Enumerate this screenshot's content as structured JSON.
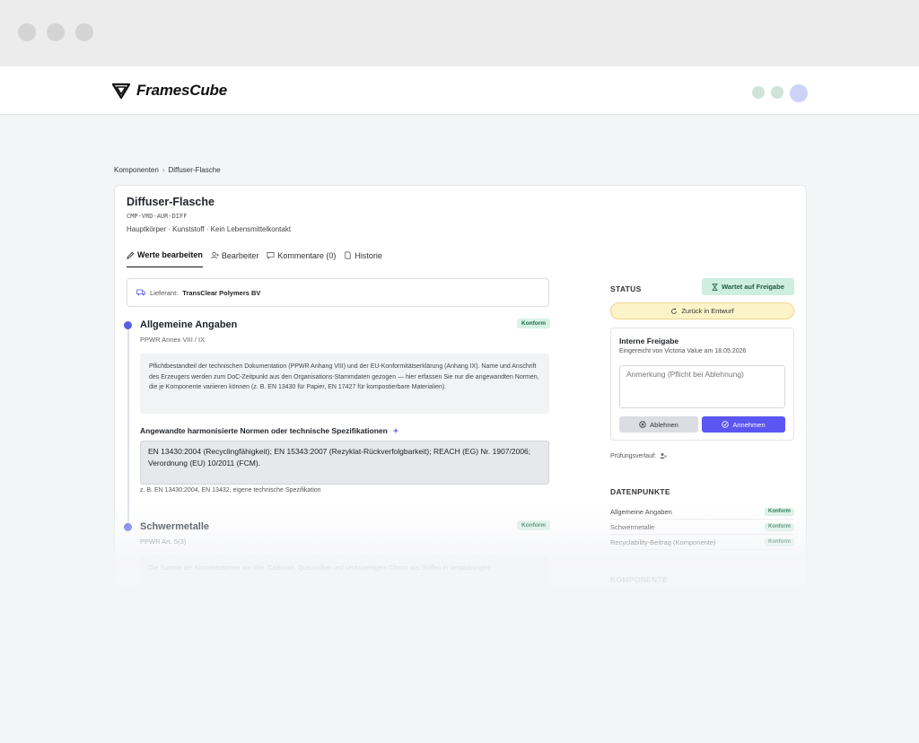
{
  "app": {
    "logo_text": "FramesCube"
  },
  "breadcrumb": {
    "parent": "Komponenten",
    "separator": "›",
    "current": "Diffuser-Flasche"
  },
  "component": {
    "title": "Diffuser-Flasche",
    "code": "CMP-VRD-AUR-DIFF",
    "meta": "Hauptkörper · Kunststoff · Kein Lebensmittelkontakt"
  },
  "tabs": [
    {
      "label": "Werte bearbeiten",
      "icon": "pencil-icon",
      "active": true
    },
    {
      "label": "Bearbeiter",
      "icon": "user-add-icon",
      "active": false
    },
    {
      "label": "Kommentare (0)",
      "icon": "comment-icon",
      "active": false
    },
    {
      "label": "Historie",
      "icon": "document-icon",
      "active": false
    }
  ],
  "supplier": {
    "label": "Lieferant:",
    "name": "TransClear Polymers BV"
  },
  "sections": [
    {
      "title": "Allgemeine Angaben",
      "subtitle": "PPWR Annex VIII / IX",
      "badge": "Konform",
      "info": "Pflichtbestandteil der technischen Dokumentation (PPWR Anhang VIII) und der EU-Konformitätserklärung (Anhang IX). Name und Anschrift des Erzeugers werden zum DoC-Zeitpunkt aus den Organisations-Stammdaten gezogen — hier erfassen Sie nur die angewandten Normen, die je Komponente variieren können (z. B. EN 13430 für Papier, EN 17427 für kompostierbare Materialien).",
      "field_label": "Angewandte harmonisierte Normen oder technische Spezifikationen",
      "field_value": "EN 13430:2004 (Recyclingfähigkeit); EN 15343:2007 (Rezyklat-Rückverfolgbarkeit); REACH (EG) Nr. 1907/2006; Verordnung (EU) 10/2011 (FCM).",
      "field_hint": "z. B. EN 13430:2004, EN 13432, eigene technische Spezifikation"
    },
    {
      "title": "Schwermetalle",
      "subtitle": "PPWR Art. 5(3)",
      "badge": "Konform",
      "info": "Die Summe der Konzentrationen von Blei, Cadmium, Quecksilber und sechswertigem Chrom aus Stoffen in Verpackungen"
    }
  ],
  "status": {
    "heading": "STATUS",
    "badge": "Wartet auf Freigabe",
    "revert_label": "Zurück in Entwurf"
  },
  "approval": {
    "title": "Interne Freigabe",
    "subtitle": "Eingereicht von Victoria Value am 18.05.2026",
    "note_placeholder": "Anmerkung (Pflicht bei Ablehnung)",
    "reject_label": "Ablehnen",
    "accept_label": "Annehmen"
  },
  "history": {
    "label": "Prüfungsverlauf:"
  },
  "datapoints": {
    "heading": "DATENPUNKTE",
    "items": [
      {
        "label": "Allgemeine Angaben",
        "badge": "Konform"
      },
      {
        "label": "Schwermetalle",
        "badge": "Konform"
      },
      {
        "label": "Recyclability-Beitrag (Komponente)",
        "badge": "Konform"
      }
    ]
  },
  "components_heading": "KOMPONENTE",
  "colors": {
    "accent": "#5b55f2",
    "success_bg": "#d9f1e6",
    "warning_bg": "#fdf3c8"
  }
}
